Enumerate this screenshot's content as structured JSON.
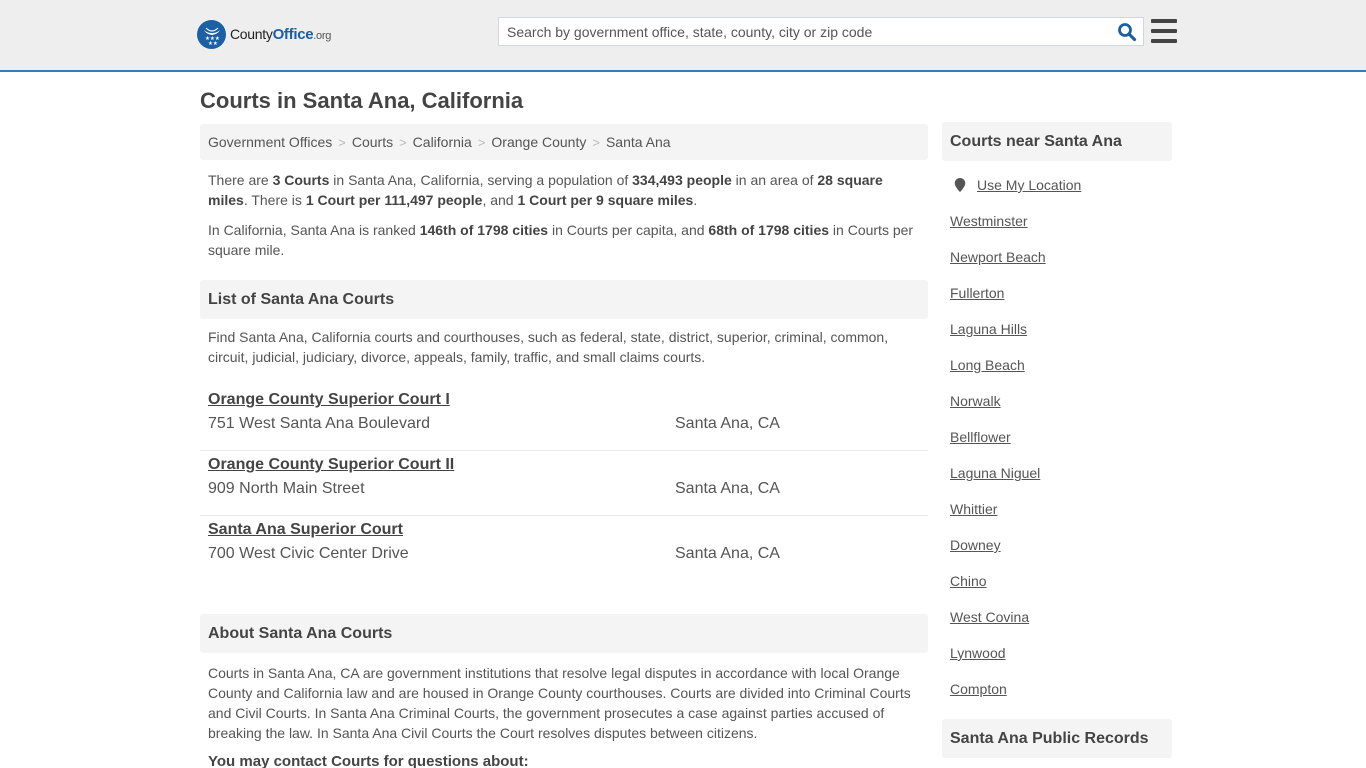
{
  "header": {
    "logo": {
      "name": "County",
      "name_bold": "Office",
      "tld": ".org",
      "icon": "eagle-stars-icon"
    },
    "search": {
      "placeholder": "Search by government office, state, county, city or zip code",
      "value": "",
      "icon": "search-icon"
    },
    "menu_icon": "hamburger-menu-icon",
    "brand_color": "#1b5fa5",
    "accent_border_color": "#3a7db1"
  },
  "page": {
    "title": "Courts in Santa Ana, California",
    "breadcrumb": [
      "Government Offices",
      "Courts",
      "California",
      "Orange County",
      "Santa Ana"
    ],
    "intro": {
      "p1": {
        "t1": "There are ",
        "b1": "3 Courts",
        "t2": " in Santa Ana, California, serving a population of ",
        "b2": "334,493 people",
        "t3": " in an area of ",
        "b3": "28 square miles",
        "t4": ". There is ",
        "b4": "1 Court per 111,497 people",
        "t5": ", and ",
        "b5": "1 Court per 9 square miles",
        "t6": "."
      },
      "p2": {
        "t1": "In California, Santa Ana is ranked ",
        "b1": "146th of 1798 cities",
        "t2": " in Courts per capita, and ",
        "b2": "68th of 1798 cities",
        "t3": " in Courts per square mile."
      }
    },
    "list_section": {
      "heading": "List of Santa Ana Courts",
      "description": "Find Santa Ana, California courts and courthouses, such as federal, state, district, superior, criminal, common, circuit, judicial, judiciary, divorce, appeals, family, traffic, and small claims courts.",
      "courts": [
        {
          "name": "Orange County Superior Court I",
          "address": "751 West Santa Ana Boulevard",
          "city": "Santa Ana, CA"
        },
        {
          "name": "Orange County Superior Court II",
          "address": "909 North Main Street",
          "city": "Santa Ana, CA"
        },
        {
          "name": "Santa Ana Superior Court",
          "address": "700 West Civic Center Drive",
          "city": "Santa Ana, CA"
        }
      ]
    },
    "about_section": {
      "heading": "About Santa Ana Courts",
      "text": "Courts in Santa Ana, CA are government institutions that resolve legal disputes in accordance with local Orange County and California law and are housed in Orange County courthouses. Courts are divided into Criminal Courts and Civil Courts. In Santa Ana Criminal Courts, the government prosecutes a case against parties accused of breaking the law. In Santa Ana Civil Courts the Court resolves disputes between citizens.",
      "contact_heading": "You may contact Courts for questions about:"
    }
  },
  "sidebar": {
    "nearby_heading": "Courts near Santa Ana",
    "use_location": {
      "label": "Use My Location",
      "icon": "map-pin-icon"
    },
    "nearby_cities": [
      "Westminster",
      "Newport Beach",
      "Fullerton",
      "Laguna Hills",
      "Long Beach",
      "Norwalk",
      "Bellflower",
      "Laguna Niguel",
      "Whittier",
      "Downey",
      "Chino",
      "West Covina",
      "Lynwood",
      "Compton"
    ],
    "records_heading": "Santa Ana Public Records"
  }
}
